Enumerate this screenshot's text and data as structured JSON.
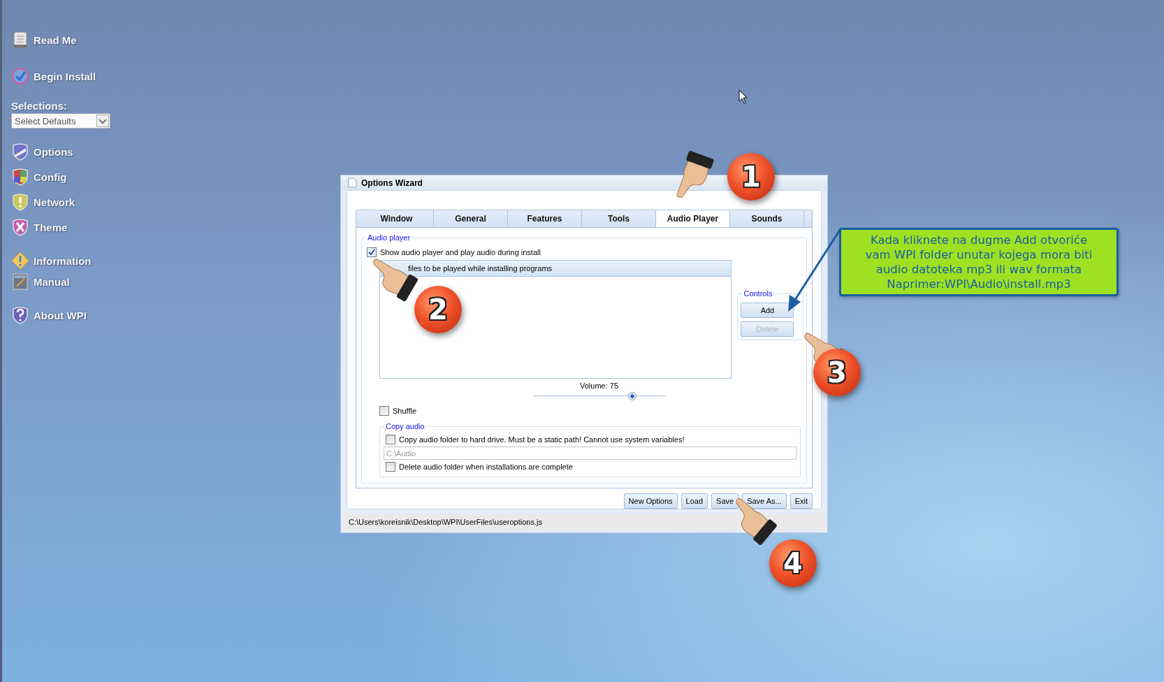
{
  "sidebar": {
    "top_items": [
      {
        "label": "Read Me",
        "kind": "document"
      },
      {
        "label": "Begin Install",
        "kind": "globe"
      }
    ],
    "selections": {
      "label": "Selections:",
      "value": "Select Defaults"
    },
    "groups": [
      [
        {
          "label": "Options",
          "kind": "options"
        },
        {
          "label": "Config",
          "kind": "config"
        },
        {
          "label": "Network",
          "kind": "network"
        },
        {
          "label": "Theme",
          "kind": "theme"
        }
      ],
      [
        {
          "label": "Information",
          "kind": "information"
        },
        {
          "label": "Manual",
          "kind": "manual"
        }
      ],
      [
        {
          "label": "About WPI",
          "kind": "about"
        }
      ]
    ]
  },
  "dialog": {
    "title": "Options Wizard",
    "tabs": [
      {
        "label": "Window",
        "selected": false
      },
      {
        "label": "General",
        "selected": false
      },
      {
        "label": "Features",
        "selected": false
      },
      {
        "label": "Tools",
        "selected": false
      },
      {
        "label": "Audio Player",
        "selected": true
      },
      {
        "label": "Sounds",
        "selected": false
      }
    ],
    "audio_group": {
      "legend": "Audio player",
      "show_player": {
        "label": "Show audio player and play audio during install",
        "checked": true
      },
      "list_header": "files to be played while installing programs",
      "controls": {
        "legend": "Controls",
        "buttons": [
          {
            "label": "Add",
            "disabled": false
          },
          {
            "label": "Delete",
            "disabled": true
          }
        ]
      },
      "volume": {
        "label": "Volume: 75",
        "level": 0.75
      },
      "shuffle": {
        "label": "Shuffle",
        "checked": false
      },
      "copy_group": {
        "legend": "Copy audio",
        "copy": {
          "label": "Copy audio folder to hard drive. Must be a static path! Cannot use system variables!",
          "checked": false
        },
        "path_field": {
          "value": "C:\\Audio",
          "disabled": true
        },
        "delete": {
          "label": "Delete audio folder when installations are complete",
          "checked": false
        }
      }
    },
    "buttons": [
      "New Options",
      "Load",
      "Save",
      "Save As...",
      "Exit"
    ],
    "status": "C:\\Users\\koreisnik\\Desktop\\WPI\\UserFiles\\useroptions.js"
  },
  "annotations": [
    {
      "number": "1"
    },
    {
      "number": "2"
    },
    {
      "number": "3"
    },
    {
      "number": "4"
    }
  ],
  "callout": {
    "lines": [
      "Kada kliknete na dugme Add otvoriće",
      "vam WPI folder unutar kojega mora biti",
      "audio datoteka mp3 ili wav formata",
      "Naprimer:WPI\\Audio\\install.mp3"
    ]
  }
}
